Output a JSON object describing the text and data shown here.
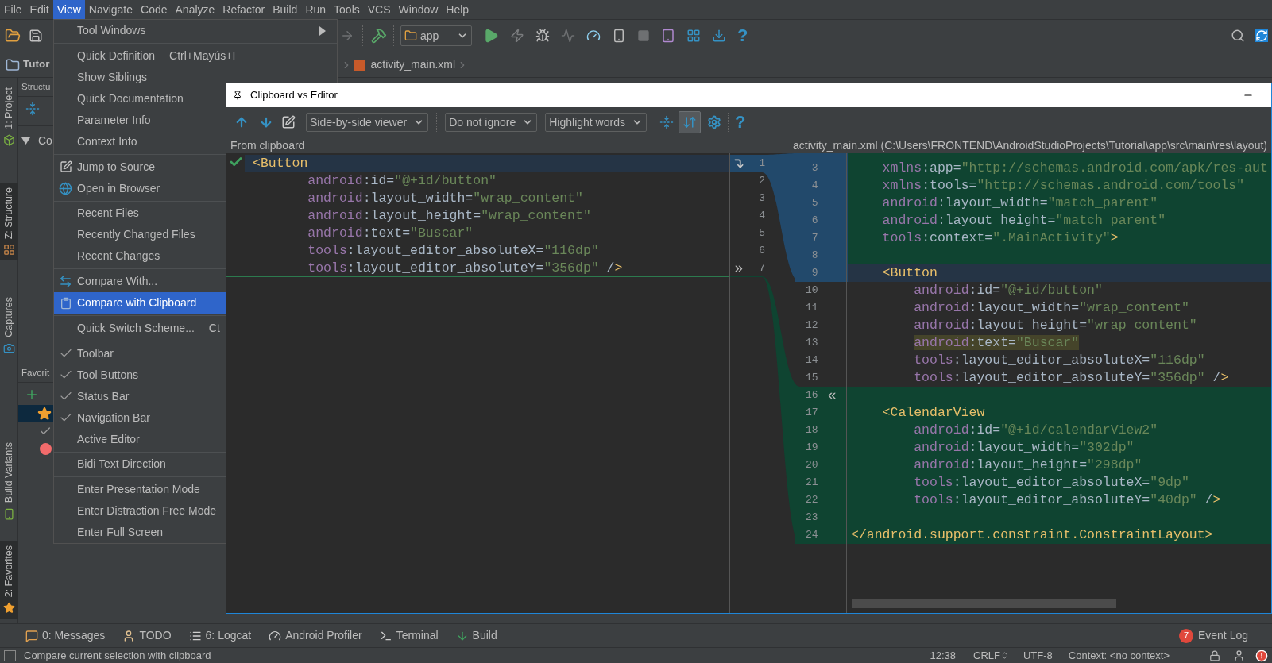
{
  "menu_bar": [
    {
      "label": "File",
      "selected": false
    },
    {
      "label": "Edit",
      "selected": false
    },
    {
      "label": "View",
      "selected": true
    },
    {
      "label": "Navigate",
      "selected": false
    },
    {
      "label": "Code",
      "selected": false
    },
    {
      "label": "Analyze",
      "selected": false
    },
    {
      "label": "Refactor",
      "selected": false
    },
    {
      "label": "Build",
      "selected": false
    },
    {
      "label": "Run",
      "selected": false
    },
    {
      "label": "Tools",
      "selected": false
    },
    {
      "label": "VCS",
      "selected": false
    },
    {
      "label": "Window",
      "selected": false
    },
    {
      "label": "Help",
      "selected": false
    }
  ],
  "toolbar": {
    "run_config": "app",
    "help": "?"
  },
  "nav_bar": {
    "project": "Tutor",
    "file_tab": "activity_main.xml"
  },
  "tool_stripe": {
    "top": [
      {
        "label": "1: Project",
        "selected": false
      },
      {
        "label": "Z: Structure",
        "selected": true
      },
      {
        "label": "Captures",
        "selected": false
      }
    ],
    "bottom": [
      {
        "label": "Build Variants",
        "selected": false
      },
      {
        "label": "2: Favorites",
        "selected": true
      }
    ]
  },
  "structure_panel": {
    "title": "Structu",
    "node": {
      "label": "Co",
      "expanded": true
    }
  },
  "favorites_panel": {
    "title": "Favorit",
    "items": [
      {
        "selected": true
      },
      {
        "selected": false
      },
      {
        "selected": false
      }
    ]
  },
  "view_menu": {
    "groups": [
      [
        {
          "label": "Tool Windows",
          "submenu": true,
          "checked": false,
          "selected": false
        }
      ],
      [
        {
          "label": "Quick Definition",
          "shortcut": "Ctrl+Mayús+I",
          "checked": false,
          "selected": false
        },
        {
          "label": "Show Siblings",
          "checked": false,
          "selected": false
        },
        {
          "label": "Quick Documentation",
          "checked": false,
          "selected": false
        },
        {
          "label": "Parameter Info",
          "checked": false,
          "selected": false
        },
        {
          "label": "Context Info",
          "checked": false,
          "selected": false
        }
      ],
      [
        {
          "label": "Jump to Source",
          "checked": false,
          "selected": false
        },
        {
          "label": "Open in Browser",
          "checked": false,
          "selected": false
        }
      ],
      [
        {
          "label": "Recent Files",
          "checked": false,
          "selected": false
        },
        {
          "label": "Recently Changed Files",
          "checked": false,
          "selected": false
        },
        {
          "label": "Recent Changes",
          "checked": false,
          "selected": false
        }
      ],
      [
        {
          "label": "Compare With...",
          "checked": false,
          "selected": false
        },
        {
          "label": "Compare with Clipboard",
          "checked": false,
          "selected": true
        }
      ],
      [
        {
          "label": "Quick Switch Scheme...",
          "shortcut": "Ct",
          "checked": false,
          "selected": false
        }
      ],
      [
        {
          "label": "Toolbar",
          "checked": true,
          "selected": false
        },
        {
          "label": "Tool Buttons",
          "checked": true,
          "selected": false
        },
        {
          "label": "Status Bar",
          "checked": true,
          "selected": false
        },
        {
          "label": "Navigation Bar",
          "checked": true,
          "selected": false
        },
        {
          "label": "Active Editor",
          "checked": false,
          "selected": false
        }
      ],
      [
        {
          "label": "Bidi Text Direction",
          "checked": false,
          "selected": false
        }
      ],
      [
        {
          "label": "Enter Presentation Mode",
          "checked": false,
          "selected": false
        },
        {
          "label": "Enter Distraction Free Mode",
          "checked": false,
          "selected": false
        },
        {
          "label": "Enter Full Screen",
          "checked": false,
          "selected": false
        }
      ]
    ]
  },
  "diff_dialog": {
    "title": "Clipboard vs Editor",
    "viewer": "Side-by-side viewer",
    "ignore": "Do not ignore",
    "highlight": "Highlight words",
    "sync_scroll": {
      "selected": true
    },
    "help": "?",
    "left_title": "From clipboard",
    "right_title": "activity_main.xml (C:\\Users\\FRONTEND\\AndroidStudioProjects\\Tutorial\\app\\src\\main\\res\\layout)",
    "left_lines": [
      {
        "number": "1",
        "text": "<Button",
        "modified": true,
        "current": true
      },
      {
        "number": "2",
        "text": "       android:id=\"@+id/button\"",
        "modified": false,
        "current": false
      },
      {
        "number": "3",
        "text": "       android:layout_width=\"wrap_content\"",
        "modified": false,
        "current": false
      },
      {
        "number": "4",
        "text": "       android:layout_height=\"wrap_content\"",
        "modified": false,
        "current": false
      },
      {
        "number": "5",
        "text": "       android:text=\"Buscar\"",
        "modified": false,
        "current": false
      },
      {
        "number": "6",
        "text": "       tools:layout_editor_absoluteX=\"116dp\"",
        "modified": false,
        "current": false
      },
      {
        "number": "7",
        "text": "       tools:layout_editor_absoluteY=\"356dp\" />",
        "modified": false,
        "current": false,
        "action": "»"
      }
    ],
    "right_lines": [
      {
        "number": "3",
        "text": "    xmlns:app=\"http://schemas.android.com/apk/res-aut",
        "modified": true,
        "inserted": false,
        "current": false,
        "changed_text": false
      },
      {
        "number": "4",
        "text": "    xmlns:tools=\"http://schemas.android.com/tools\"",
        "modified": true,
        "inserted": false,
        "current": false,
        "changed_text": false
      },
      {
        "number": "5",
        "text": "    android:layout_width=\"match_parent\"",
        "modified": true,
        "inserted": false,
        "current": false,
        "changed_text": false
      },
      {
        "number": "6",
        "text": "    android:layout_height=\"match_parent\"",
        "modified": true,
        "inserted": false,
        "current": false,
        "changed_text": false
      },
      {
        "number": "7",
        "text": "    tools:context=\".MainActivity\">",
        "modified": true,
        "inserted": false,
        "current": false,
        "changed_text": false
      },
      {
        "number": "8",
        "modified": true,
        "inserted": false,
        "current": false,
        "changed_text": false
      },
      {
        "number": "9",
        "text": "    <Button",
        "modified": true,
        "inserted": false,
        "current": true,
        "changed_text": false
      },
      {
        "number": "10",
        "text": "        android:id=\"@+id/button\"",
        "modified": false,
        "inserted": false,
        "current": false,
        "changed_text": false
      },
      {
        "number": "11",
        "text": "        android:layout_width=\"wrap_content\"",
        "modified": false,
        "inserted": false,
        "current": false,
        "changed_text": false
      },
      {
        "number": "12",
        "text": "        android:layout_height=\"wrap_content\"",
        "modified": false,
        "inserted": false,
        "current": false,
        "changed_text": false
      },
      {
        "number": "13",
        "text": "        android:text=\"Buscar\"",
        "modified": false,
        "inserted": false,
        "current": false,
        "changed_text": true
      },
      {
        "number": "14",
        "text": "        tools:layout_editor_absoluteX=\"116dp\"",
        "modified": false,
        "inserted": false,
        "current": false,
        "changed_text": false
      },
      {
        "number": "15",
        "text": "        tools:layout_editor_absoluteY=\"356dp\" />",
        "modified": false,
        "inserted": false,
        "current": false,
        "changed_text": false
      },
      {
        "number": "16",
        "modified": false,
        "inserted": true,
        "current": false,
        "changed_text": false,
        "action": "«"
      },
      {
        "number": "17",
        "text": "    <CalendarView",
        "modified": false,
        "inserted": true,
        "current": false,
        "changed_text": false
      },
      {
        "number": "18",
        "text": "        android:id=\"@+id/calendarView2\"",
        "modified": false,
        "inserted": true,
        "current": false,
        "changed_text": false
      },
      {
        "number": "19",
        "text": "        android:layout_width=\"302dp\"",
        "modified": false,
        "inserted": true,
        "current": false,
        "changed_text": false
      },
      {
        "number": "20",
        "text": "        android:layout_height=\"298dp\"",
        "modified": false,
        "inserted": true,
        "current": false,
        "changed_text": false
      },
      {
        "number": "21",
        "text": "        tools:layout_editor_absoluteX=\"9dp\"",
        "modified": false,
        "inserted": true,
        "current": false,
        "changed_text": false
      },
      {
        "number": "22",
        "text": "        tools:layout_editor_absoluteY=\"40dp\" />",
        "modified": false,
        "inserted": true,
        "current": false,
        "changed_text": false
      },
      {
        "number": "23",
        "modified": false,
        "inserted": true,
        "current": false,
        "changed_text": false
      },
      {
        "number": "24",
        "text": "</android.support.constraint.ConstraintLayout>",
        "modified": false,
        "inserted": true,
        "current": false,
        "changed_text": false
      }
    ]
  },
  "tool_window_bar": {
    "tabs": [
      {
        "label": "0: Messages"
      },
      {
        "label": "TODO"
      },
      {
        "label": "6: Logcat"
      },
      {
        "label": "Android Profiler"
      },
      {
        "label": "Terminal"
      },
      {
        "label": "Build"
      }
    ],
    "event_log": {
      "count": "7",
      "label": "Event Log"
    }
  },
  "status_bar": {
    "message": "Compare current selection with clipboard",
    "position": "12:38",
    "line_separator": "CRLF",
    "encoding": "UTF-8",
    "context": "Context: <no context>"
  }
}
